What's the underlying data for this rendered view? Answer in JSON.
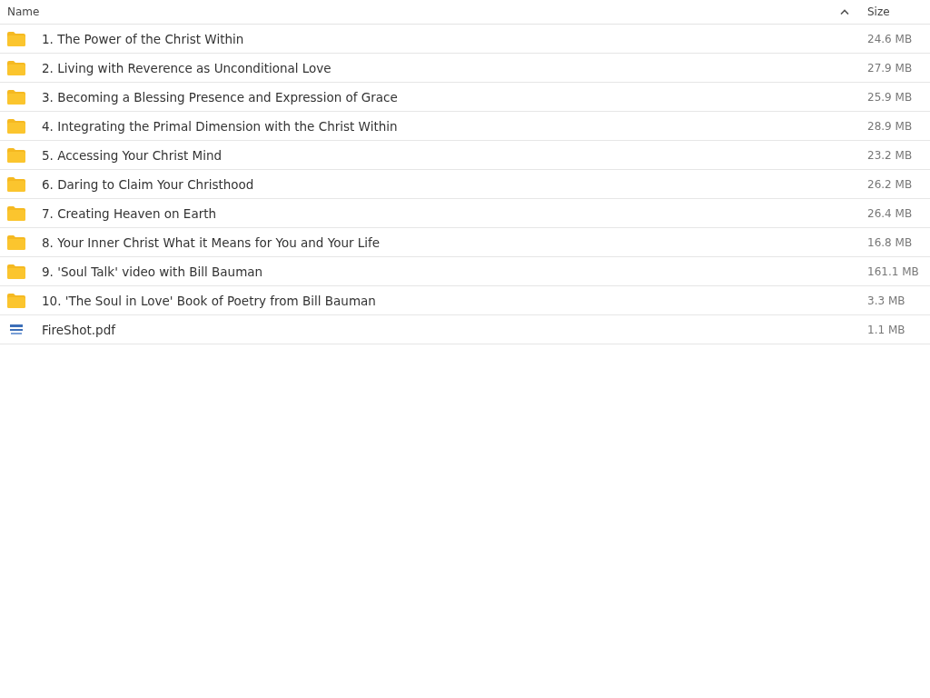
{
  "table": {
    "columns": [
      {
        "label": "Name",
        "sorted": true
      },
      {
        "label": "Size"
      }
    ],
    "rows": [
      {
        "kind": "folder",
        "name": "1. The Power of the Christ Within",
        "size": "24.6 MB"
      },
      {
        "kind": "folder",
        "name": "2. Living with Reverence as Unconditional Love",
        "size": "27.9 MB"
      },
      {
        "kind": "folder",
        "name": "3. Becoming a Blessing Presence and Expression of Grace",
        "size": "25.9 MB"
      },
      {
        "kind": "folder",
        "name": "4. Integrating the Primal Dimension with the Christ Within",
        "size": "28.9 MB"
      },
      {
        "kind": "folder",
        "name": "5. Accessing Your Christ Mind",
        "size": "23.2 MB"
      },
      {
        "kind": "folder",
        "name": "6. Daring to Claim Your Christhood",
        "size": "26.2 MB"
      },
      {
        "kind": "folder",
        "name": "7. Creating Heaven on Earth",
        "size": "26.4 MB"
      },
      {
        "kind": "folder",
        "name": "8. Your Inner Christ What it Means for You and Your Life",
        "size": "16.8 MB"
      },
      {
        "kind": "folder",
        "name": "9. 'Soul Talk' video with Bill Bauman",
        "size": "161.1 MB"
      },
      {
        "kind": "folder",
        "name": "10. 'The Soul in Love' Book of Poetry from Bill Bauman",
        "size": "3.3 MB"
      },
      {
        "kind": "file",
        "name": "FireShot.pdf",
        "size": "1.1 MB"
      }
    ]
  }
}
